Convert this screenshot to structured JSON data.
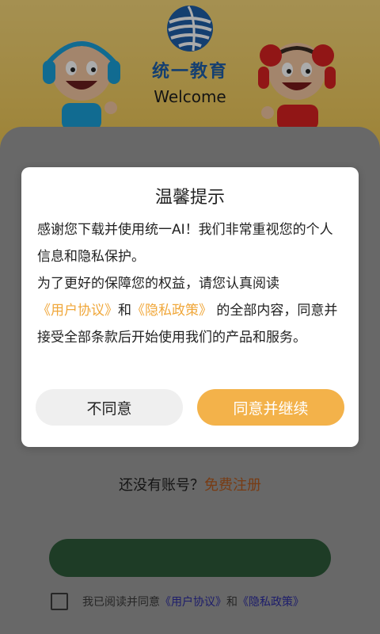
{
  "brand": {
    "name": "统一教育",
    "welcome": "Welcome"
  },
  "signup": {
    "prompt": "还没有账号？",
    "link": "免费注册"
  },
  "agreement": {
    "prefix": "我已阅读并同意",
    "user_agreement": "《用户协议》",
    "and": "和",
    "privacy_policy": "《隐私政策》"
  },
  "dialog": {
    "title": "温馨提示",
    "lines": [
      "感谢您下载并使用统一AI！我们非常重视您的个人信息和隐私保护。",
      "为了更好的保障您的权益，请您认真阅读"
    ],
    "user_agreement": "《用户协议》",
    "and": "和",
    "privacy_policy": "《隐私政策》",
    "tail": " 的全部内容，同意并接受全部条款后开始使用我们的产品和服务。",
    "buttons": {
      "disagree": "不同意",
      "agree": "同意并继续"
    }
  },
  "colors": {
    "header_yellow": "#f0cb5f",
    "brand_blue": "#1f5fa8",
    "accent_orange": "#f3b24a",
    "link_orange": "#f0a73a",
    "signup_link": "#b35a1f",
    "agreement_link": "#2c2ca0"
  }
}
